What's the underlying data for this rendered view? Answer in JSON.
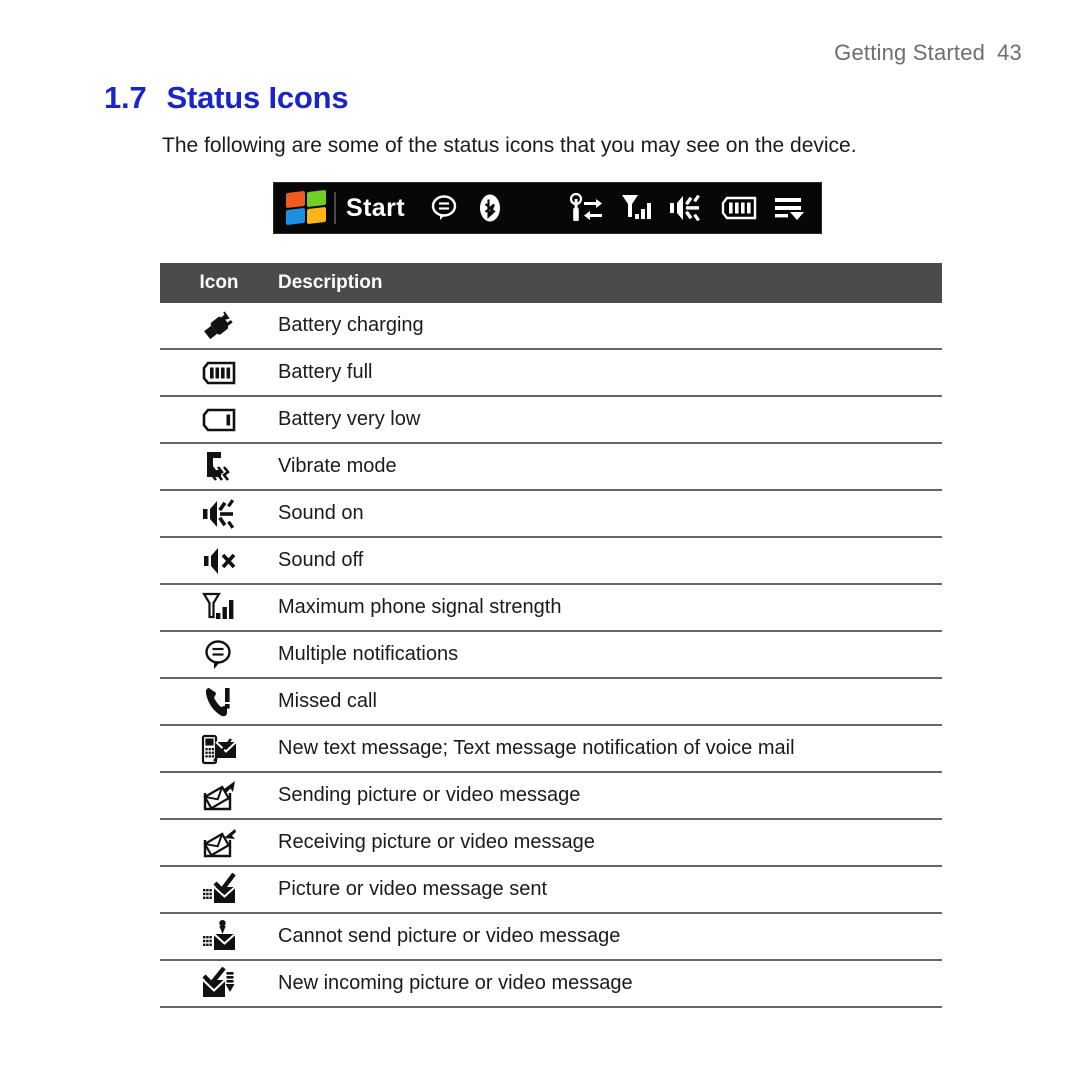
{
  "running_header": {
    "text": "Getting Started",
    "page_number": "43"
  },
  "section": {
    "number": "1.7",
    "title": "Status Icons",
    "accent_color": "#1a25c8"
  },
  "intro": "The following are some of the status icons that you may see on the device.",
  "status_bar": {
    "background_color": "#060606",
    "logo": "windows-logo-icon",
    "start_label": "Start",
    "left_icons": [
      "multiple-notifications-icon",
      "bluetooth-icon"
    ],
    "right_icons": [
      "data-connection-icon",
      "signal-strength-icon",
      "sound-on-icon",
      "battery-full-icon",
      "menu-arrow-icon"
    ]
  },
  "table": {
    "header_background": "#4b4b4b",
    "columns": [
      "Icon",
      "Description"
    ],
    "rows": [
      {
        "icon": "battery-charging-icon",
        "description": "Battery charging"
      },
      {
        "icon": "battery-full-icon",
        "description": "Battery full"
      },
      {
        "icon": "battery-very-low-icon",
        "description": "Battery very low"
      },
      {
        "icon": "vibrate-mode-icon",
        "description": "Vibrate mode"
      },
      {
        "icon": "sound-on-icon",
        "description": "Sound on"
      },
      {
        "icon": "sound-off-icon",
        "description": "Sound off"
      },
      {
        "icon": "signal-strength-icon",
        "description": "Maximum phone signal strength"
      },
      {
        "icon": "multiple-notifications-icon",
        "description": "Multiple notifications"
      },
      {
        "icon": "missed-call-icon",
        "description": "Missed call"
      },
      {
        "icon": "new-text-message-icon",
        "description": "New text message; Text message notification of voice mail"
      },
      {
        "icon": "sending-picture-message-icon",
        "description": "Sending picture or video message"
      },
      {
        "icon": "receiving-picture-message-icon",
        "description": "Receiving picture or video message"
      },
      {
        "icon": "picture-message-sent-icon",
        "description": "Picture or video message sent"
      },
      {
        "icon": "cannot-send-picture-icon",
        "description": "Cannot send picture or video message"
      },
      {
        "icon": "new-incoming-picture-icon",
        "description": "New incoming picture or video message"
      }
    ]
  }
}
